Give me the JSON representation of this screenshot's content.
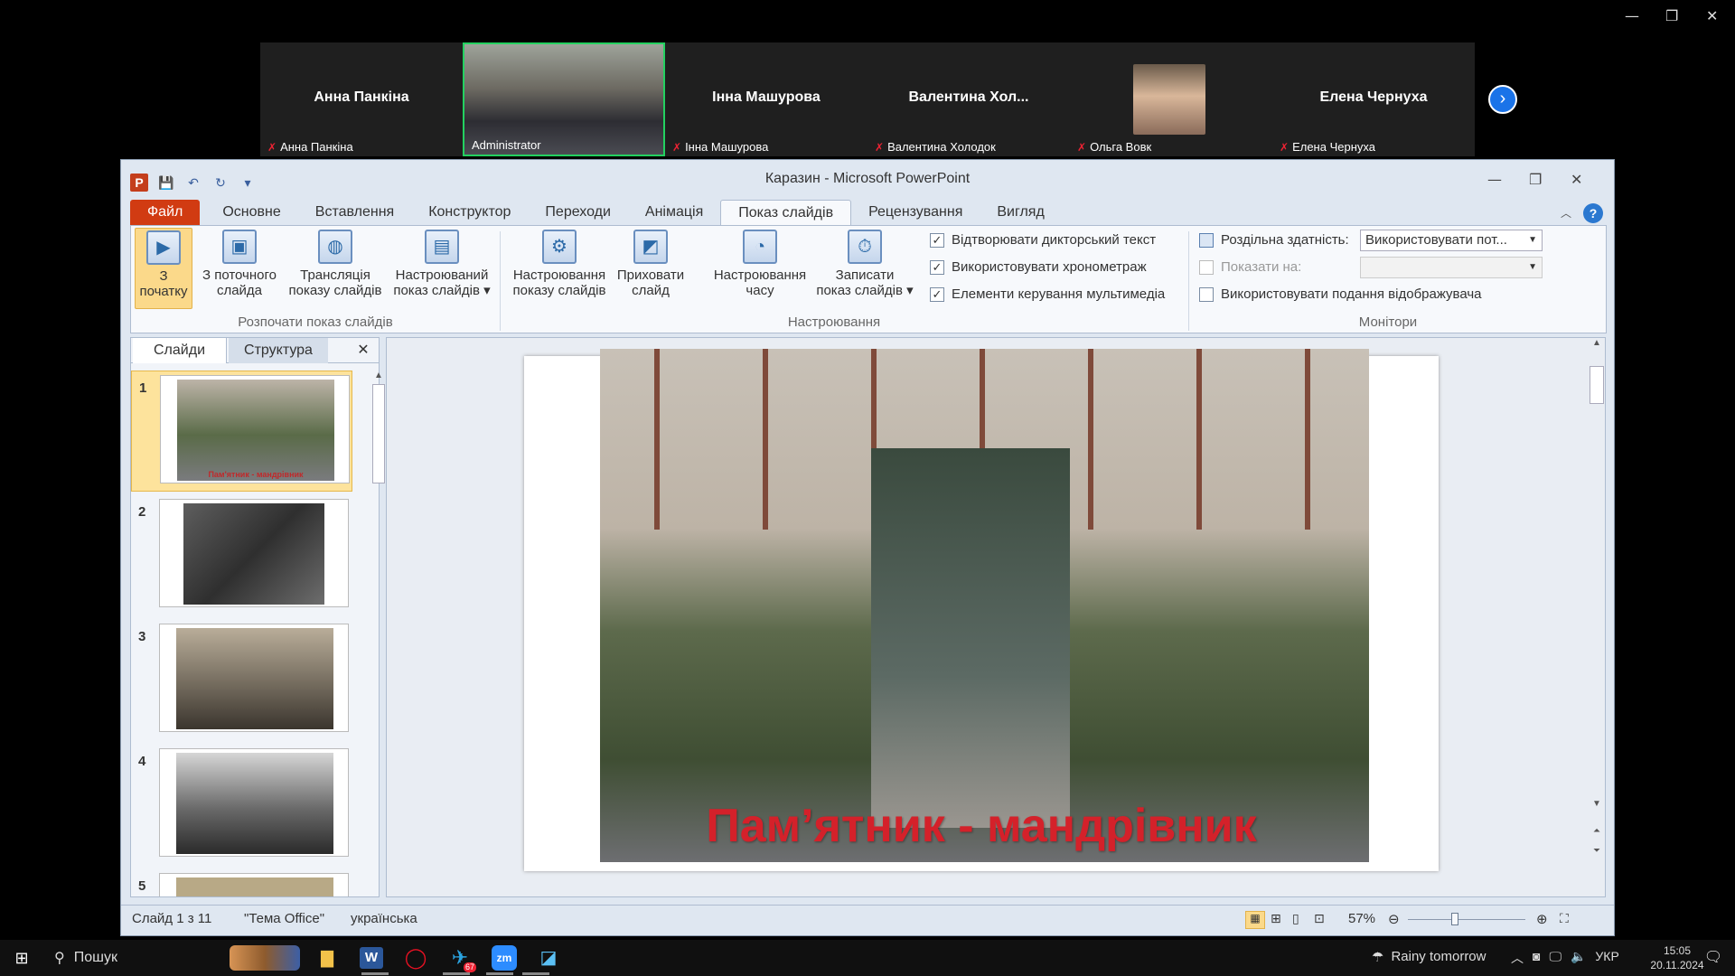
{
  "zoom": {
    "participants": [
      {
        "name": "Анна Панкіна",
        "label": "Анна Панкіна",
        "video": false,
        "muted": true
      },
      {
        "name": "",
        "label": "Administrator",
        "video": true,
        "muted": false,
        "active": true
      },
      {
        "name": "Інна Машурова",
        "label": "Інна Машурова",
        "video": false,
        "muted": true
      },
      {
        "name": "Валентина  Хол...",
        "label": "Валентина Холодок",
        "video": false,
        "muted": true
      },
      {
        "name": "",
        "label": "Ольга Вовк",
        "video": true,
        "muted": true
      },
      {
        "name": "Елена Чернуха",
        "label": "Елена Чернуха",
        "video": false,
        "muted": true
      }
    ],
    "next_icon": "›"
  },
  "ppt": {
    "title": "Каразин  -  Microsoft PowerPoint",
    "tabs": [
      "Файл",
      "Основне",
      "Вставлення",
      "Конструктор",
      "Переходи",
      "Анімація",
      "Показ слайдів",
      "Рецензування",
      "Вигляд"
    ],
    "active_tab": "Показ слайдів",
    "ribbon": {
      "start_group": "Розпочати показ слайдів",
      "setup_group": "Настроювання",
      "monitors_group": "Монітори",
      "btn_from_beginning": "З\nпочатку",
      "btn_from_current": "З поточного\nслайда",
      "btn_broadcast": "Трансляція\nпоказу слайдів",
      "btn_custom": "Настроюваний\nпоказ слайдів ▾",
      "btn_setup": "Настроювання\nпоказу слайдів",
      "btn_hide": "Приховати\nслайд",
      "btn_timing": "Настроювання\nчасу",
      "btn_record": "Записати\nпоказ слайдів ▾",
      "chk_narration": "Відтворювати дикторський текст",
      "chk_timings": "Використовувати хронометраж",
      "chk_media": "Елементи керування мультимедіа",
      "resolution_label": "Роздільна здатність:",
      "resolution_value": "Використовувати пот...",
      "show_on_label": "Показати на:",
      "show_on_value": "",
      "presenter_view": "Використовувати подання відображувача"
    },
    "pane_tabs": [
      "Слайди",
      "Структура"
    ],
    "thumbs": [
      {
        "num": "1",
        "caption": "Пам'ятник - мандрівник"
      },
      {
        "num": "2",
        "caption": ""
      },
      {
        "num": "3",
        "caption": ""
      },
      {
        "num": "4",
        "caption": ""
      },
      {
        "num": "5",
        "caption": ""
      }
    ],
    "slide_title": "Пам’ятник - мандрівник",
    "status": {
      "slide": "Слайд 1 з 11",
      "theme": "\"Тема Office\"",
      "lang": "українська",
      "zoom": "57%",
      "zoom_fraction": 0.4
    }
  },
  "taskbar": {
    "search": "Пошук",
    "weather": "Rainy tomorrow",
    "lang": "УКР",
    "time": "15:05",
    "date": "20.11.2024",
    "telegram_badge": "67"
  }
}
